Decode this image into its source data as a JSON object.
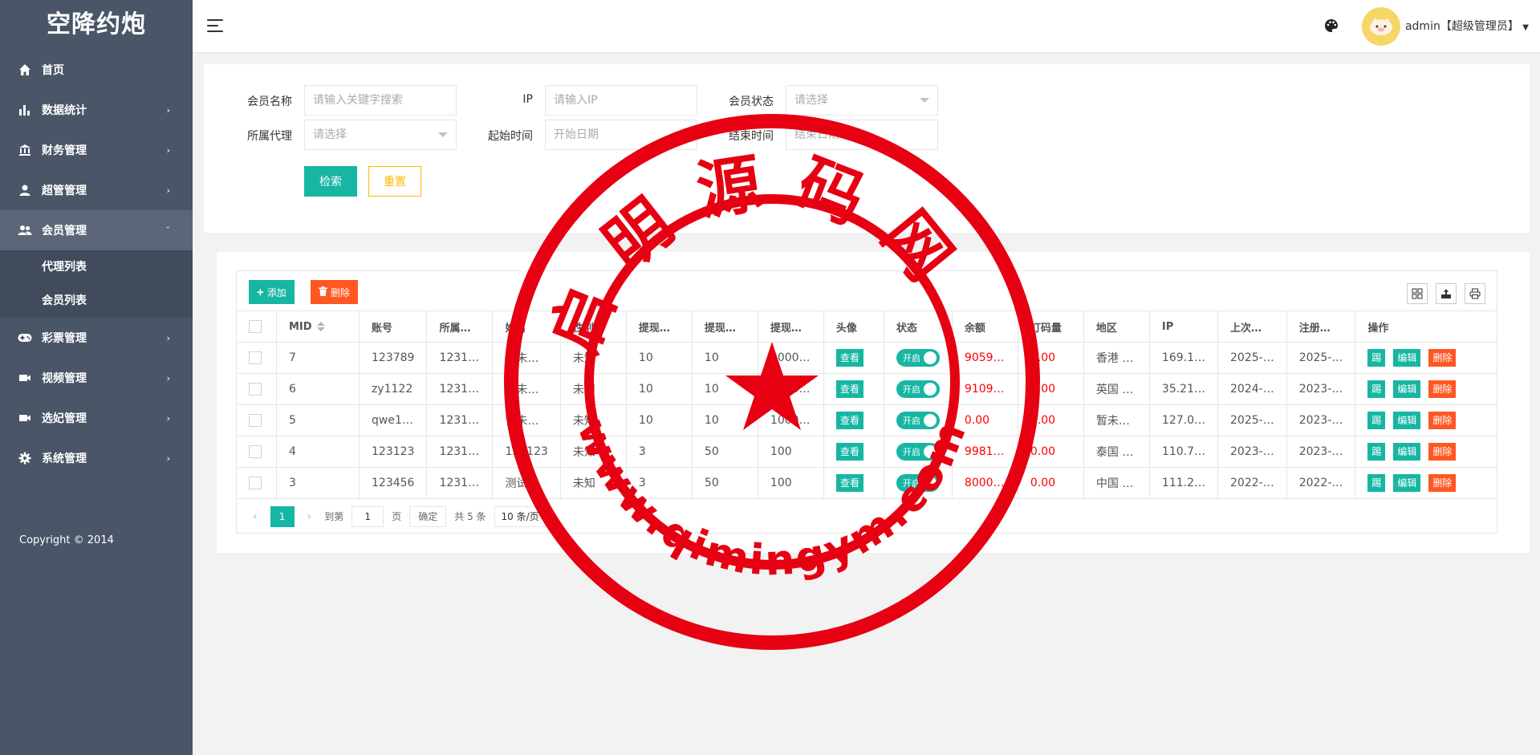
{
  "sidebar": {
    "brand": "空降约炮",
    "items": [
      {
        "label": "首页",
        "icon": "home-icon"
      },
      {
        "label": "数据统计",
        "icon": "bar-chart-icon"
      },
      {
        "label": "财务管理",
        "icon": "bank-icon"
      },
      {
        "label": "超管管理",
        "icon": "user-icon"
      },
      {
        "label": "会员管理",
        "icon": "users-icon"
      },
      {
        "label": "彩票管理",
        "icon": "gamepad-icon"
      },
      {
        "label": "视频管理",
        "icon": "video-icon"
      },
      {
        "label": "选妃管理",
        "icon": "video-icon"
      },
      {
        "label": "系统管理",
        "icon": "gear-icon"
      }
    ],
    "submenu": [
      "代理列表",
      "会员列表"
    ],
    "copyright": "Copyright © 2014"
  },
  "header": {
    "user": "admin【超级管理员】"
  },
  "search": {
    "member_name_label": "会员名称",
    "member_name_placeholder": "请输入关键字搜索",
    "ip_label": "IP",
    "ip_placeholder": "请输入IP",
    "status_label": "会员状态",
    "status_value": "请选择",
    "agent_label": "所属代理",
    "agent_value": "请选择",
    "start_label": "起始时间",
    "start_placeholder": "开始日期",
    "end_label": "结束时间",
    "end_placeholder": "结束日期",
    "search_btn": "检索",
    "reset_btn": "重置"
  },
  "toolbar": {
    "add": "添加",
    "delete": "删除"
  },
  "table": {
    "headers": [
      "MID",
      "账号",
      "所属…",
      "姓名",
      "性别",
      "提现…",
      "提现…",
      "提现…",
      "头像",
      "状态",
      "余额",
      "打码量",
      "地区",
      "IP",
      "上次…",
      "注册…",
      "操作"
    ],
    "rows": [
      [
        "7",
        "123789",
        "1231…",
        "暂未…",
        "未知",
        "10",
        "10",
        "1000…",
        "9059…",
        "0.00",
        "香港 …",
        "169.1…",
        "2025-…",
        "2025-…"
      ],
      [
        "6",
        "zy1122",
        "1231…",
        "暂未…",
        "未知",
        "10",
        "10",
        "1000…",
        "9109…",
        "0.00",
        "英国 …",
        "35.21…",
        "2024-…",
        "2023-…"
      ],
      [
        "5",
        "qwe1…",
        "1231…",
        "暂未…",
        "未知",
        "10",
        "10",
        "1000…",
        "0.00",
        "0.00",
        "暂未…",
        "127.0…",
        "2025-…",
        "2023-…"
      ],
      [
        "4",
        "123123",
        "1231…",
        "123123",
        "未知",
        "3",
        "50",
        "100",
        "9981…",
        "0.00",
        "泰国 …",
        "110.7…",
        "2023-…",
        "2023-…"
      ],
      [
        "3",
        "123456",
        "1231…",
        "测试",
        "未知",
        "3",
        "50",
        "100",
        "8000…",
        "0.00",
        "中国 …",
        "111.2…",
        "2022-…",
        "2022-…"
      ]
    ],
    "view_label": "查看",
    "switch_label": "开启",
    "kick_label": "踢",
    "edit_label": "编辑",
    "delete_label": "删除"
  },
  "pager": {
    "current": "1",
    "goto_label": "到第",
    "goto_value": "1",
    "page_label": "页",
    "confirm": "确定",
    "total": "共 5 条",
    "size": "10 条/页"
  },
  "watermark": {
    "top_text": "启明源码网",
    "bottom_text": "www.qimingym.com"
  },
  "colors": {
    "sidebar_bg": "#4a5568",
    "accent": "#16b6a3",
    "danger": "#ff5722",
    "warning": "#ffb800",
    "stamp": "#e60012"
  }
}
